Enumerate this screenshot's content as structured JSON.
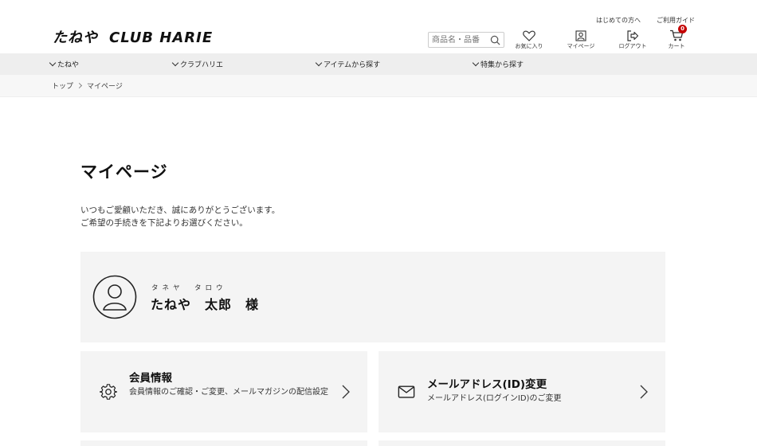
{
  "header": {
    "logo_tane": "たねや",
    "logo_club": "CLUB HARIE",
    "top_links": [
      "はじめての方へ",
      "ご利用ガイド"
    ],
    "search_placeholder": "商品名・品番",
    "icons": [
      {
        "name": "heart-icon",
        "label": "お気に入り"
      },
      {
        "name": "user-icon",
        "label": "マイページ"
      },
      {
        "name": "logout-icon",
        "label": "ログアウト"
      },
      {
        "name": "cart-icon",
        "label": "カート"
      }
    ],
    "cart_count": "0"
  },
  "nav": {
    "items": [
      "たねや",
      "クラブハリエ",
      "アイテムから探す",
      "特集から探す"
    ]
  },
  "breadcrumb": {
    "home": "トップ",
    "current": "マイページ"
  },
  "main": {
    "title": "マイページ",
    "intro_line1": "いつもご愛顧いただき、誠にありがとうございます。",
    "intro_line2": "ご希望の手続きを下記よりお選びください。",
    "user": {
      "ruby": "タネヤ　タロウ",
      "name": "たねや　太郎　様"
    },
    "cards": [
      {
        "title": "会員情報",
        "desc": "会員情報のご確認・ご変更、メールマガジンの配信設定",
        "icon": "gear-icon"
      },
      {
        "title": "メールアドレス(ID)変更",
        "desc": "メールアドレス(ログインID)のご変更",
        "icon": "mail-icon"
      }
    ]
  },
  "colors": {
    "nav_bg": "#eeeeee",
    "card_bg": "#f4f4f4",
    "badge": "#c40000"
  }
}
